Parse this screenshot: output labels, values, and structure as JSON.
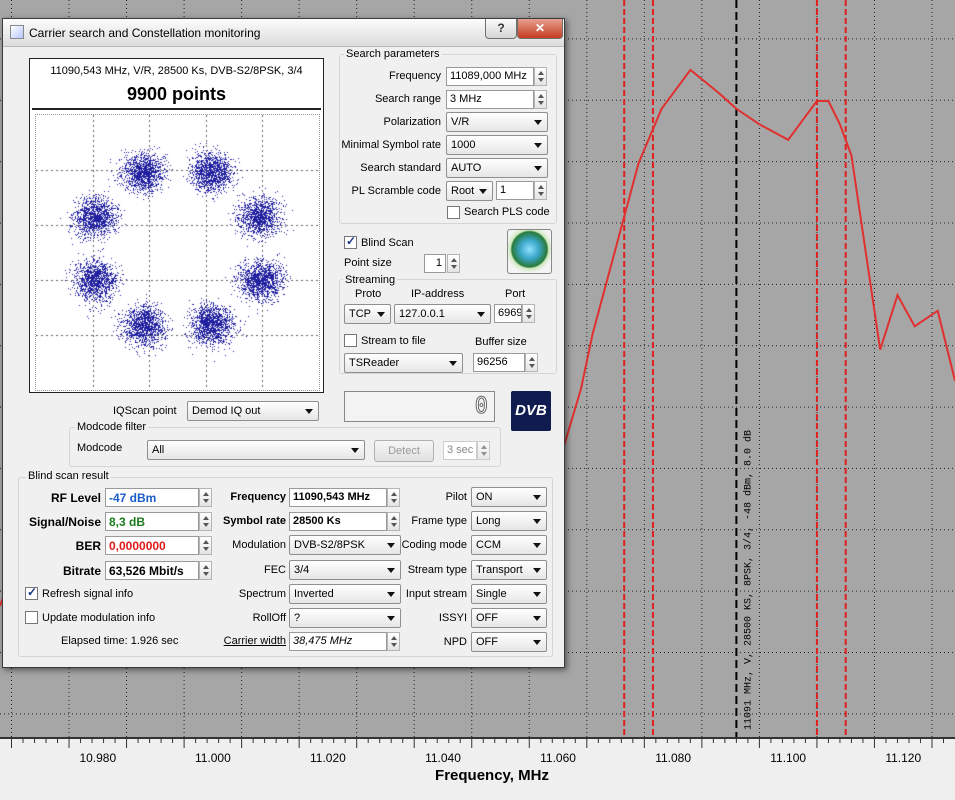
{
  "window": {
    "title": "Carrier search and Constellation monitoring",
    "help_btn": "?",
    "close_btn": "✕"
  },
  "constellation": {
    "header": "11090,543 MHz, V/R, 28500 Ks, DVB-S2/8PSK, 3/4",
    "points_label": "9900 points"
  },
  "search": {
    "group_title": "Search parameters",
    "frequency_label": "Frequency",
    "frequency_value": "11089,000 MHz",
    "range_label": "Search range",
    "range_value": "3 MHz",
    "polarization_label": "Polarization",
    "polarization_value": "V/R",
    "min_sr_label": "Minimal Symbol rate",
    "min_sr_value": "1000",
    "standard_label": "Search standard",
    "standard_value": "AUTO",
    "pls_label": "PL Scramble code",
    "pls_mode": "Root",
    "pls_value": "1",
    "search_pls_label": "Search PLS code"
  },
  "blind_scan": {
    "label": "Blind Scan",
    "point_size_label": "Point size",
    "point_size_value": "1"
  },
  "streaming": {
    "group_title": "Streaming",
    "proto_label": "Proto",
    "ip_label": "IP-address",
    "port_label": "Port",
    "proto_value": "TCP",
    "ip_value": "127.0.0.1",
    "port_value": "6969",
    "stream_to_file_label": "Stream to file",
    "buffer_label": "Buffer size",
    "reader_value": "TSReader",
    "buffer_value": "96256"
  },
  "iqscan": {
    "label": "IQScan point",
    "value": "Demod IQ out",
    "display": "0"
  },
  "dvb_logo": "DVB",
  "modcode": {
    "group_title": "Modcode filter",
    "label": "Modcode",
    "value": "All",
    "detect_label": "Detect",
    "sec_value": "3 sec"
  },
  "result": {
    "group_title": "Blind scan result",
    "rf_label": "RF Level",
    "rf_value": "-47 dBm",
    "sn_label": "Signal/Noise",
    "sn_value": "8,3 dB",
    "ber_label": "BER",
    "ber_value": "0,0000000",
    "bitrate_label": "Bitrate",
    "bitrate_value": "63,526 Mbit/s",
    "refresh_label": "Refresh signal info",
    "update_label": "Update modulation info",
    "elapsed": "Elapsed time: 1.926 sec",
    "freq_label": "Frequency",
    "freq_value": "11090,543 MHz",
    "sr_label": "Symbol rate",
    "sr_value": "28500 Ks",
    "mod_label": "Modulation",
    "mod_value": "DVB-S2/8PSK",
    "fec_label": "FEC",
    "fec_value": "3/4",
    "spectrum_label": "Spectrum",
    "spectrum_value": "Inverted",
    "rolloff_label": "RollOff",
    "rolloff_value": "?",
    "cw_label": "Carrier width",
    "cw_value": "38,475 MHz",
    "pilot_label": "Pilot",
    "pilot_value": "ON",
    "frame_label": "Frame type",
    "frame_value": "Long",
    "coding_label": "Coding mode",
    "coding_value": "CCM",
    "stype_label": "Stream type",
    "stype_value": "Transport",
    "istream_label": "Input stream",
    "istream_value": "Single",
    "issyi_label": "ISSYI",
    "issyi_value": "OFF",
    "npd_label": "NPD",
    "npd_value": "OFF"
  },
  "chart_data": {
    "type": "line",
    "xlabel": "Frequency, MHz",
    "xlim": [
      10.963,
      11.129
    ],
    "ticks": [
      "10.980",
      "11.000",
      "11.020",
      "11.040",
      "11.060",
      "11.080",
      "11.100",
      "11.120"
    ],
    "tick_values": [
      10.98,
      11.0,
      11.02,
      11.04,
      11.06,
      11.08,
      11.1,
      11.12
    ],
    "marker_label": "11091 MHz, V, 28500 KS, 8PSK, 3/4, -48 dBm, 8.0 dB",
    "marker_x": 11.091,
    "red_lines": [
      11.0715,
      11.0765,
      11.105,
      11.11
    ],
    "series": [
      {
        "color": "#e03030",
        "x": [
          10.963,
          10.967,
          10.969,
          10.975,
          11.035,
          11.038,
          11.043,
          11.047,
          11.05,
          11.052,
          11.055,
          11.06,
          11.064,
          11.066,
          11.07,
          11.074,
          11.078,
          11.083,
          11.088,
          11.091,
          11.095,
          11.1,
          11.103,
          11.105,
          11.107,
          11.109,
          11.111,
          11.116,
          11.119,
          11.122,
          11.126,
          11.129
        ],
        "y": [
          -78,
          -70,
          -72,
          -77,
          -82,
          -85,
          -84,
          -82,
          -80,
          -76,
          -70,
          -60,
          -50,
          -43,
          -32,
          -21,
          -14,
          -9,
          -12,
          -14,
          -16,
          -18,
          -15,
          -13,
          -13,
          -16,
          -20,
          -45,
          -38,
          -42,
          -40,
          -49
        ]
      }
    ]
  }
}
